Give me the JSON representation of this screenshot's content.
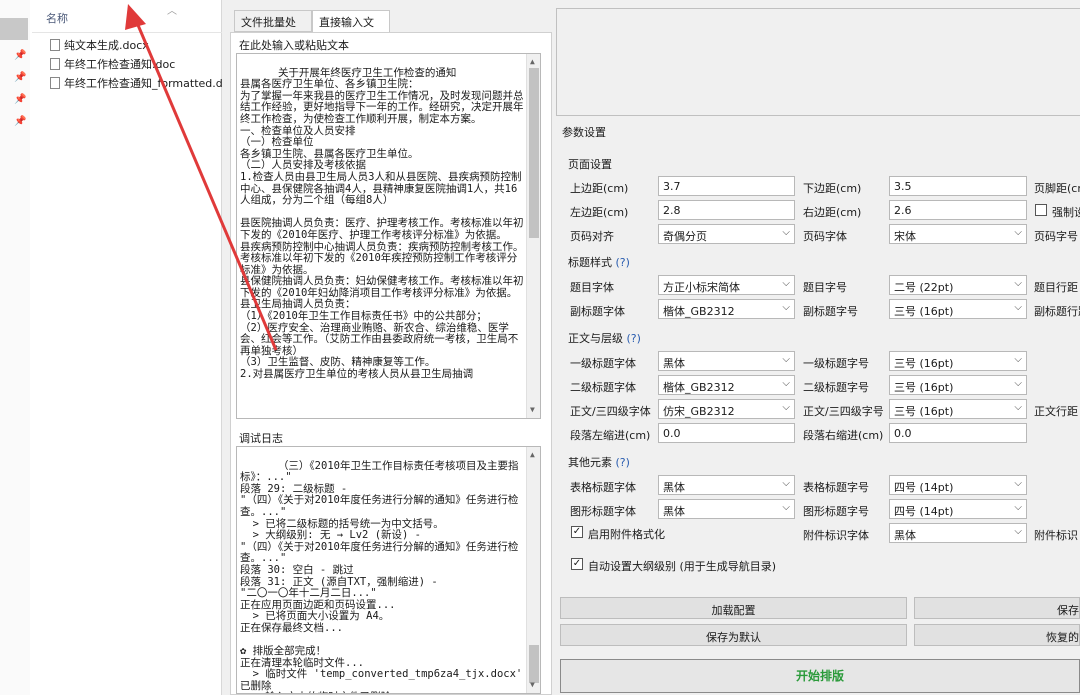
{
  "explorer": {
    "header": "名称",
    "files": [
      "纯文本生成.docx",
      "年终工作检查通知.doc",
      "年终工作检查通知_formatted.docx"
    ]
  },
  "tabs": [
    "文件批量处理",
    "直接输入文本"
  ],
  "input_area": {
    "label": "在此处输入或粘贴文本",
    "text": "关于开展年终医疗卫生工作检查的通知\n县属各医疗卫生单位、各乡镇卫生院：\n为了掌握一年来我县的医疗卫生工作情况，及时发现问题并总结工作经验，更好地指导下一年的工作。经研究，决定开展年终工作检查，为使检查工作顺利开展，制定本方案。\n一、检查单位及人员安排\n（一）检查单位\n各乡镇卫生院、县属各医疗卫生单位。\n（二）人员安排及考核依据\n1.检查人员由县卫生局人员3人和从县医院、县疾病预防控制中心、县保健院各抽调4人，县精神康复医院抽调1人，共16人组成，分为二个组（每组8人）\n\n县医院抽调人员负责：医疗、护理考核工作。考核标准以年初下发的《2010年医疗、护理工作考核评分标准》为依据。\n县疾病预防控制中心抽调人员负责：疾病预防控制考核工作。考核标准以年初下发的《2010年疾控预防控制工作考核评分标准》为依据。\n县保健院抽调人员负责：妇幼保健考核工作。考核标准以年初下发的《2010年妇幼降消项目工作考核评分标准》为依据。\n县卫生局抽调人员负责：\n（1）《2010年卫生工作目标责任书》中的公共部分；\n（2）医疗安全、治理商业贿赂、新农合、综治维稳、医学会、红会等工作。（艾防工作由县委政府统一考核，卫生局不再单独考核）\n（3）卫生监督、皮防、精神康复等工作。\n2.对县属医疗卫生单位的考核人员从县卫生局抽调"
  },
  "log_area": {
    "label": "调试日志",
    "text": "（三）《2010年卫生工作目标责任考核项目及主要指标》：...\"\n段落 29: 二级标题 -\n\"（四）《关于对2010年度任务进行分解的通知》任务进行检查。...\"\n  > 已将二级标题的括号统一为中文括号。\n  > 大纲级别: 无 → Lv2 (新设) -\n\"（四）《关于对2010年度任务进行分解的通知》任务进行检查。...\"\n段落 30: 空白 - 跳过\n段落 31: 正文 (源自TXT，强制缩进) -\n\"二〇一〇年十二月二日...\"\n正在应用页面边距和页码设置...\n  > 已将页面大小设置为 A4。\n正在保存最终文档...\n\n✿ 排版全部完成！\n正在清理本轮临时文件...\n  > 临时文件 'temp_converted_tmp6za4_tjx.docx' 已删除\n  > 输入文本的临时文件已删除"
  },
  "params": {
    "title": "参数设置",
    "page": {
      "title": "页面设置",
      "top_margin_label": "上边距(cm)",
      "top_margin": "3.7",
      "bottom_margin_label": "下边距(cm)",
      "bottom_margin": "3.5",
      "footer_label": "页脚距(cm",
      "left_margin_label": "左边距(cm)",
      "left_margin": "2.8",
      "right_margin_label": "右边距(cm)",
      "right_margin": "2.6",
      "force_label": "强制设",
      "pagenum_align_label": "页码对齐",
      "pagenum_align": "奇偶分页",
      "pagenum_font_label": "页码字体",
      "pagenum_font": "宋体",
      "pagenum_size_label": "页码字号"
    },
    "heading": {
      "title": "标题样式",
      "help": "(?)",
      "title_font_label": "题目字体",
      "title_font": "方正小标宋简体",
      "title_size_label": "题目字号",
      "title_size": "二号 (22pt)",
      "title_spacing_label": "题目行距",
      "subtitle_font_label": "副标题字体",
      "subtitle_font": "楷体_GB2312",
      "subtitle_size_label": "副标题字号",
      "subtitle_size": "三号 (16pt)",
      "subtitle_spacing_label": "副标题行距"
    },
    "body": {
      "title": "正文与层级",
      "help": "(?)",
      "h1_font_label": "一级标题字体",
      "h1_font": "黑体",
      "h1_size_label": "一级标题字号",
      "h1_size": "三号 (16pt)",
      "h2_font_label": "二级标题字体",
      "h2_font": "楷体_GB2312",
      "h2_size_label": "二级标题字号",
      "h2_size": "三号 (16pt)",
      "body_font_label": "正文/三四级字体",
      "body_font": "仿宋_GB2312",
      "body_size_label": "正文/三四级字号",
      "body_size": "三号 (16pt)",
      "body_spacing_label": "正文行距",
      "left_indent_label": "段落左缩进(cm)",
      "left_indent": "0.0",
      "right_indent_label": "段落右缩进(cm)",
      "right_indent": "0.0"
    },
    "other": {
      "title": "其他元素",
      "help": "(?)",
      "table_font_label": "表格标题字体",
      "table_font": "黑体",
      "table_size_label": "表格标题字号",
      "table_size": "四号 (14pt)",
      "figure_font_label": "图形标题字体",
      "figure_font": "黑体",
      "figure_size_label": "图形标题字号",
      "figure_size": "四号 (14pt)",
      "attach_enable_label": "启用附件格式化",
      "attach_font_label": "附件标识字体",
      "attach_font": "黑体",
      "attach_size_label": "附件标识"
    },
    "outline_label": "自动设置大纲级别 (用于生成导航目录)"
  },
  "buttons": {
    "load": "加载配置",
    "save": "保存",
    "save_default": "保存为默认",
    "restore": "恢复的",
    "start": "开始排版"
  },
  "colors": {
    "accent": "#2a9a3a",
    "arrow": "#e03a3a"
  }
}
